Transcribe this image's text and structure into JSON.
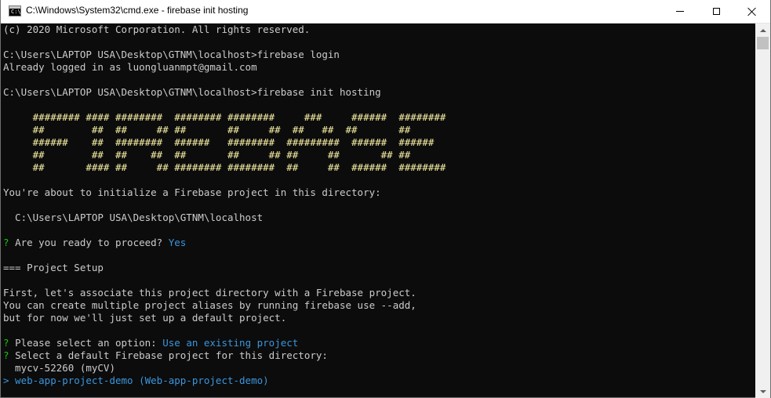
{
  "window": {
    "title": "C:\\Windows\\System32\\cmd.exe - firebase  init hosting",
    "icon_label": "C:\\"
  },
  "console": {
    "lines": [
      {
        "t": "(c) 2020 Microsoft Corporation. All rights reserved."
      },
      {
        "t": ""
      },
      {
        "t": "C:\\Users\\LAPTOP USA\\Desktop\\GTNM\\localhost>firebase login"
      },
      {
        "t": "Already logged in as luongluanmpt@gmail.com"
      },
      {
        "t": ""
      },
      {
        "t": "C:\\Users\\LAPTOP USA\\Desktop\\GTNM\\localhost>firebase init hosting"
      },
      {
        "t": ""
      },
      {
        "t": "     ######## #### ########  ######## ########     ###     ######  ########",
        "c": "yellow"
      },
      {
        "t": "     ##        ##  ##     ## ##       ##     ##  ##   ##  ##       ##",
        "c": "yellow"
      },
      {
        "t": "     ######    ##  ########  ######   ########  #########  ######  ######",
        "c": "yellow"
      },
      {
        "t": "     ##        ##  ##    ##  ##       ##     ## ##     ##       ## ##",
        "c": "yellow"
      },
      {
        "t": "     ##       #### ##     ## ######## ########  ##     ##  ######  ########",
        "c": "yellow"
      },
      {
        "t": ""
      },
      {
        "t": "You're about to initialize a Firebase project in this directory:"
      },
      {
        "t": ""
      },
      {
        "t": "  C:\\Users\\LAPTOP USA\\Desktop\\GTNM\\localhost"
      },
      {
        "t": ""
      },
      {
        "segs": [
          {
            "t": "? ",
            "c": "green"
          },
          {
            "t": "Are you ready to proceed? "
          },
          {
            "t": "Yes",
            "c": "cyan"
          }
        ]
      },
      {
        "t": ""
      },
      {
        "t": "=== Project Setup"
      },
      {
        "t": ""
      },
      {
        "t": "First, let's associate this project directory with a Firebase project."
      },
      {
        "t": "You can create multiple project aliases by running firebase use --add,"
      },
      {
        "t": "but for now we'll just set up a default project."
      },
      {
        "t": ""
      },
      {
        "segs": [
          {
            "t": "? ",
            "c": "green"
          },
          {
            "t": "Please select an option: "
          },
          {
            "t": "Use an existing project",
            "c": "cyan"
          }
        ]
      },
      {
        "segs": [
          {
            "t": "? ",
            "c": "green"
          },
          {
            "t": "Select a default Firebase project for this directory:"
          }
        ]
      },
      {
        "t": "  mycv-52260 (myCV)"
      },
      {
        "segs": [
          {
            "t": "> web-app-project-demo (Web-app-project-demo)",
            "c": "cyan"
          }
        ]
      }
    ]
  }
}
